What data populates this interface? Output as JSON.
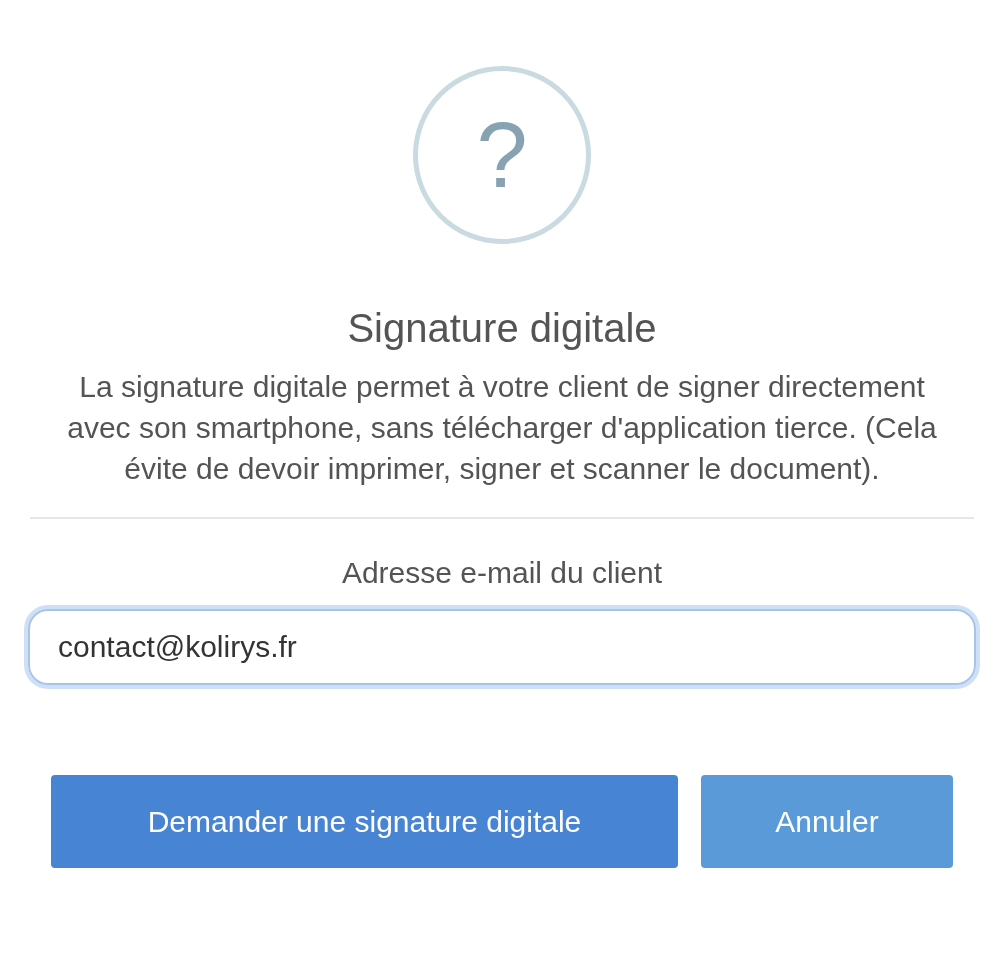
{
  "icon": "?",
  "title": "Signature digitale",
  "description": "La signature digitale permet à votre client de signer directement avec son smartphone, sans télécharger d'application tierce. (Cela évite de devoir imprimer, signer et scanner le document).",
  "email_field": {
    "label": "Adresse e-mail du client",
    "value": "contact@kolirys.fr",
    "focused": true
  },
  "buttons": [
    {
      "label": "Demander une signature digitale",
      "kind": "primary"
    },
    {
      "label": "Annuler",
      "kind": "secondary"
    }
  ]
}
